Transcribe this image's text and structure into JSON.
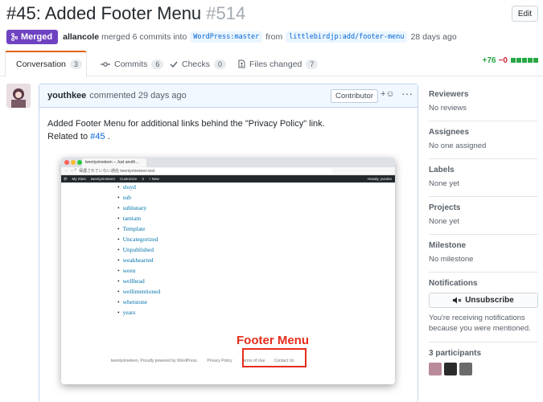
{
  "header": {
    "title": "#45: Added Footer Menu",
    "number": "#514",
    "edit_label": "Edit"
  },
  "meta": {
    "status": "Merged",
    "author": "allancole",
    "action": "merged 6 commits into",
    "base_branch": "WordPress:master",
    "from_word": "from",
    "head_branch": "littlebirdjp:add/footer-menu",
    "time": "28 days ago"
  },
  "tabs": [
    {
      "label": "Conversation",
      "count": "3"
    },
    {
      "label": "Commits",
      "count": "6"
    },
    {
      "label": "Checks",
      "count": "0"
    },
    {
      "label": "Files changed",
      "count": "7"
    }
  ],
  "diffstat": {
    "additions": "+76",
    "deletions": "−0"
  },
  "comment": {
    "author": "youthkee",
    "action": "commented 29 days ago",
    "role": "Contributor",
    "line1": "Added Footer Menu for additional links behind the \"Privacy Policy\" link.",
    "line2_prefix": "Related to",
    "line2_link": "#45",
    "line2_suffix": "."
  },
  "screenshot": {
    "tab_title": "twentynineteen – Just anoth…",
    "url": "保護されていない通信  twentynineteen.test",
    "wp_bar": [
      "My Sites",
      "twentynineteen",
      "Customize",
      "3",
      "+ New"
    ],
    "wp_bar_right": "Howdy, yusuke",
    "links": [
      "sloyd",
      "sub",
      "sublunary",
      "tamtam",
      "Template",
      "Uncategorized",
      "Unpublished",
      "weakhearted",
      "ween",
      "wellhead",
      "wellintentioned",
      "whetstone",
      "years"
    ],
    "footer_text": "twentynineteen, Proudly powered by WordPress.",
    "footer_links": [
      "Privacy Policy",
      "Terms of Use",
      "Contact Us"
    ],
    "annotation": "Footer Menu"
  },
  "sidebar": {
    "reviewers": {
      "title": "Reviewers",
      "value": "No reviews"
    },
    "assignees": {
      "title": "Assignees",
      "value": "No one assigned"
    },
    "labels": {
      "title": "Labels",
      "value": "None yet"
    },
    "projects": {
      "title": "Projects",
      "value": "None yet"
    },
    "milestone": {
      "title": "Milestone",
      "value": "No milestone"
    },
    "notifications": {
      "title": "Notifications",
      "button": "Unsubscribe",
      "text": "You're receiving notifications because you were mentioned."
    },
    "participants": {
      "title": "3 participants"
    }
  },
  "colors": {
    "merged": "#6f42c1",
    "link": "#0366d6",
    "additions": "#28a745",
    "deletions": "#cb2431",
    "annotation": "#e52d1b"
  }
}
